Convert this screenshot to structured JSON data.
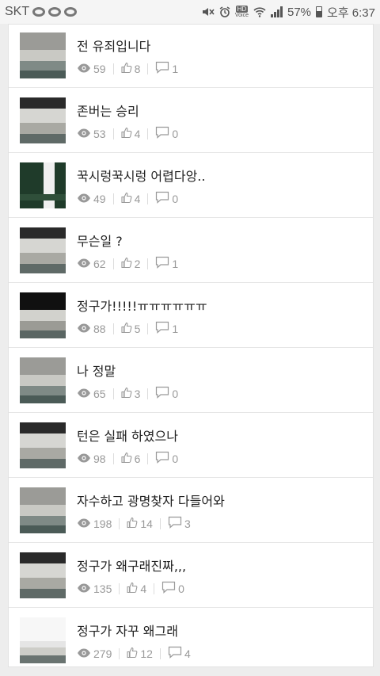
{
  "status_bar": {
    "carrier": "SKT",
    "hd_label": "HD",
    "voice_label": "Voice",
    "battery": "57%",
    "time": "오후 6:37"
  },
  "colors": {
    "meta_text": "#999999",
    "title_text": "#222222",
    "background": "#ededed"
  },
  "posts": [
    {
      "title": "전 유죄입니다",
      "views": "59",
      "likes": "8",
      "comments": "1",
      "thumb": "plaza"
    },
    {
      "title": "존버는 승리",
      "views": "53",
      "likes": "4",
      "comments": "0",
      "thumb": "dark-top"
    },
    {
      "title": "꾹시렁꾹시렁 어렵다앙..",
      "views": "49",
      "likes": "4",
      "comments": "0",
      "thumb": "chalkboard"
    },
    {
      "title": "무슨일 ?",
      "views": "62",
      "likes": "2",
      "comments": "1",
      "thumb": "dark-top"
    },
    {
      "title": "정구가!!!!!ㅠㅠㅠㅠㅠㅠ",
      "views": "88",
      "likes": "5",
      "comments": "1",
      "thumb": "black-top"
    },
    {
      "title": "나 정말",
      "views": "65",
      "likes": "3",
      "comments": "0",
      "thumb": "plaza"
    },
    {
      "title": "턴은 실패 하였으나",
      "views": "98",
      "likes": "6",
      "comments": "0",
      "thumb": "dark-top"
    },
    {
      "title": "자수하고 광명찾자 다들어와",
      "views": "198",
      "likes": "14",
      "comments": "3",
      "thumb": "plaza"
    },
    {
      "title": "정구가 왜구래진짜,,,",
      "views": "135",
      "likes": "4",
      "comments": "0",
      "thumb": "dark-top"
    },
    {
      "title": "정구가 자꾸 왜그래",
      "views": "279",
      "likes": "12",
      "comments": "4",
      "thumb": "screenshot"
    }
  ]
}
